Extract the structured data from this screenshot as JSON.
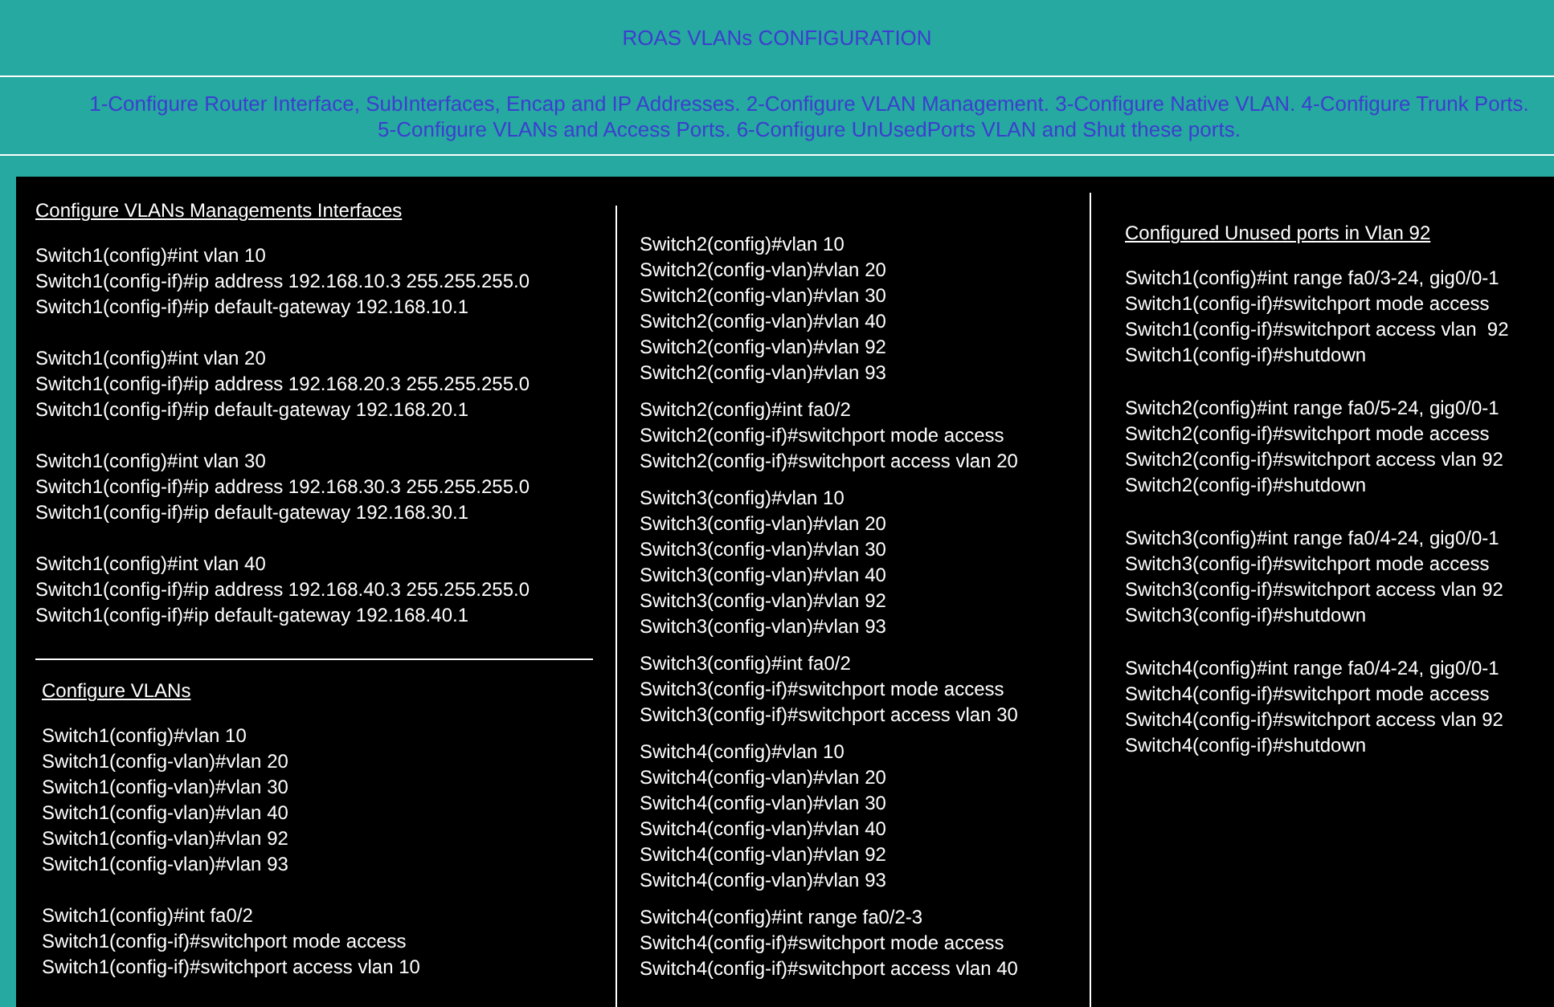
{
  "title": "ROAS VLANs CONFIGURATION",
  "steps": [
    "1-Configure Router Interface, SubInterfaces, Encap and IP Addresses. 2-Configure VLAN Management. 3-Configure Native VLAN. 4-Configure Trunk Ports.",
    "5-Configure VLANs and Access Ports. 6-Configure UnUsedPorts VLAN and Shut these ports."
  ],
  "columns": [
    {
      "sections": [
        {
          "heading": "Configure VLANs Managements Interfaces",
          "blocks": [
            [
              "Switch1(config)#int vlan 10",
              "Switch1(config-if)#ip address 192.168.10.3 255.255.255.0",
              "Switch1(config-if)#ip default-gateway 192.168.10.1"
            ],
            [
              "Switch1(config)#int vlan 20",
              "Switch1(config-if)#ip address 192.168.20.3 255.255.255.0",
              "Switch1(config-if)#ip default-gateway 192.168.20.1"
            ],
            [
              "Switch1(config)#int vlan 30",
              "Switch1(config-if)#ip address 192.168.30.3 255.255.255.0",
              "Switch1(config-if)#ip default-gateway 192.168.30.1"
            ],
            [
              "Switch1(config)#int vlan 40",
              "Switch1(config-if)#ip address 192.168.40.3 255.255.255.0",
              "Switch1(config-if)#ip default-gateway 192.168.40.1"
            ]
          ]
        },
        {
          "heading": "Configure VLANs",
          "blocks": [
            [
              "Switch1(config)#vlan 10",
              "Switch1(config-vlan)#vlan 20",
              "Switch1(config-vlan)#vlan 30",
              "Switch1(config-vlan)#vlan 40",
              "Switch1(config-vlan)#vlan 92",
              "Switch1(config-vlan)#vlan 93"
            ],
            [
              "Switch1(config)#int fa0/2",
              "Switch1(config-if)#switchport mode access",
              "Switch1(config-if)#switchport access vlan 10"
            ]
          ]
        }
      ]
    },
    {
      "sections": [
        {
          "blocks": [
            [
              "Switch2(config)#vlan 10",
              "Switch2(config-vlan)#vlan 20",
              "Switch2(config-vlan)#vlan 30",
              "Switch2(config-vlan)#vlan 40",
              "Switch2(config-vlan)#vlan 92",
              "Switch2(config-vlan)#vlan 93"
            ],
            [
              "Switch2(config)#int fa0/2",
              "Switch2(config-if)#switchport mode access",
              "Switch2(config-if)#switchport access vlan 20"
            ],
            [
              "Switch3(config)#vlan 10",
              "Switch3(config-vlan)#vlan 20",
              "Switch3(config-vlan)#vlan 30",
              "Switch3(config-vlan)#vlan 40",
              "Switch3(config-vlan)#vlan 92",
              "Switch3(config-vlan)#vlan 93"
            ],
            [
              "Switch3(config)#int fa0/2",
              "Switch3(config-if)#switchport mode access",
              "Switch3(config-if)#switchport access vlan 30"
            ],
            [
              "Switch4(config)#vlan 10",
              "Switch4(config-vlan)#vlan 20",
              "Switch4(config-vlan)#vlan 30",
              "Switch4(config-vlan)#vlan 40",
              "Switch4(config-vlan)#vlan 92",
              "Switch4(config-vlan)#vlan 93"
            ],
            [
              "Switch4(config)#int range fa0/2-3",
              "Switch4(config-if)#switchport mode access",
              "Switch4(config-if)#switchport access vlan 40"
            ]
          ]
        }
      ]
    },
    {
      "sections": [
        {
          "heading": "Configured Unused ports in Vlan 92",
          "blocks": [
            [
              "Switch1(config)#int range fa0/3-24, gig0/0-1",
              "Switch1(config-if)#switchport mode access",
              "Switch1(config-if)#switchport access vlan  92",
              "Switch1(config-if)#shutdown"
            ],
            [
              "Switch2(config)#int range fa0/5-24, gig0/0-1",
              "Switch2(config-if)#switchport mode access",
              "Switch2(config-if)#switchport access vlan 92",
              "Switch2(config-if)#shutdown"
            ],
            [
              "Switch3(config)#int range fa0/4-24, gig0/0-1",
              "Switch3(config-if)#switchport mode access",
              "Switch3(config-if)#switchport access vlan 92",
              "Switch3(config-if)#shutdown"
            ],
            [
              "Switch4(config)#int range fa0/4-24, gig0/0-1",
              "Switch4(config-if)#switchport mode access",
              "Switch4(config-if)#switchport access vlan 92",
              "Switch4(config-if)#shutdown"
            ]
          ]
        }
      ]
    }
  ]
}
